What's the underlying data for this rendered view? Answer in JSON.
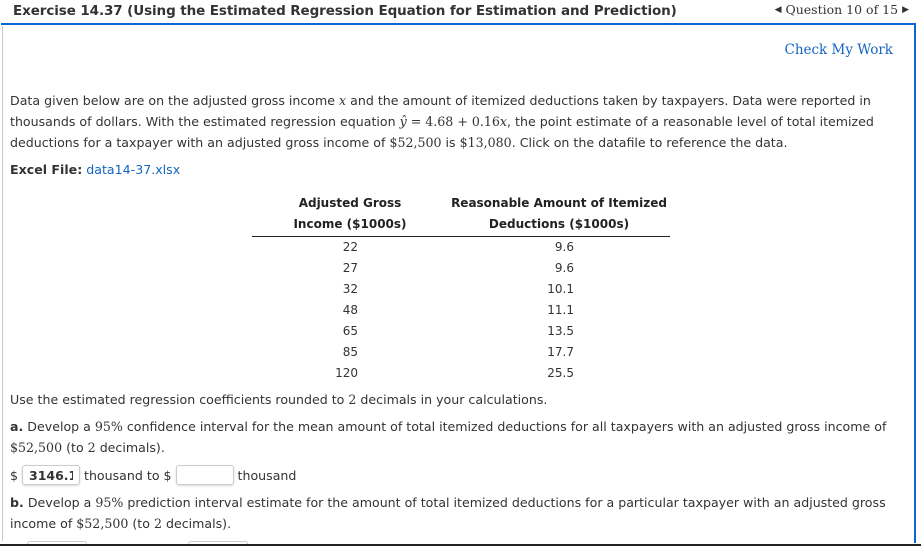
{
  "header": {
    "title": "Exercise 14.37 (Using the Estimated Regression Equation for Estimation and Prediction)",
    "question_nav": "Question 10 of 15",
    "prev_icon": "◀",
    "next_icon": "▶"
  },
  "check_my_work": "Check My Work",
  "intro": {
    "line1_a": "Data given below are on the adjusted gross income ",
    "line1_x": "x",
    "line1_b": " and the amount of itemized deductions taken by taxpayers. Data were reported in thousands of dollars. With the estimated regression equation ",
    "equation_lhs": "ŷ",
    "equation_rhs": " = 4.68 + 0.16",
    "equation_x": "x",
    "line2_b": ", the point estimate of a reasonable level of total itemized deductions for a taxpayer with an adjusted gross income of ",
    "income": "$52,500",
    "line2_c": " is ",
    "estimate": "$13,080",
    "line2_d": ". Click on the datafile to reference the data."
  },
  "excel": {
    "label": "Excel File:",
    "file": "data14-37.xlsx"
  },
  "table": {
    "headers": [
      [
        "Adjusted Gross",
        "Income ($1000s)"
      ],
      [
        "Reasonable Amount of Itemized",
        "Deductions ($1000s)"
      ]
    ],
    "rows": [
      [
        "22",
        "9.6"
      ],
      [
        "27",
        "9.6"
      ],
      [
        "32",
        "10.1"
      ],
      [
        "48",
        "11.1"
      ],
      [
        "65",
        "13.5"
      ],
      [
        "85",
        "17.7"
      ],
      [
        "120",
        "25.5"
      ]
    ]
  },
  "instructions": {
    "a1": "Use the estimated regression coefficients rounded to ",
    "a2": "2",
    "a3": " decimals in your calculations."
  },
  "part_a": {
    "label": "a.",
    "t1": " Develop a ",
    "pct": "95%",
    "t2": " confidence interval for the mean amount of total itemized deductions for all taxpayers with an adjusted gross income of ",
    "income": "$52,500",
    "t3": " (to ",
    "dec": "2",
    "t4": " decimals).",
    "currency": "$",
    "lower_value": "3146.1",
    "between": "thousand to $",
    "upper_value": "",
    "unit": "thousand"
  },
  "part_b": {
    "label": "b.",
    "t1": " Develop a ",
    "pct": "95%",
    "t2": " prediction interval estimate for the amount of total itemized deductions for a particular taxpayer with an adjusted gross income of ",
    "income": "$52,500",
    "t3": " (to ",
    "dec": "2",
    "t4": " decimals)."
  }
}
